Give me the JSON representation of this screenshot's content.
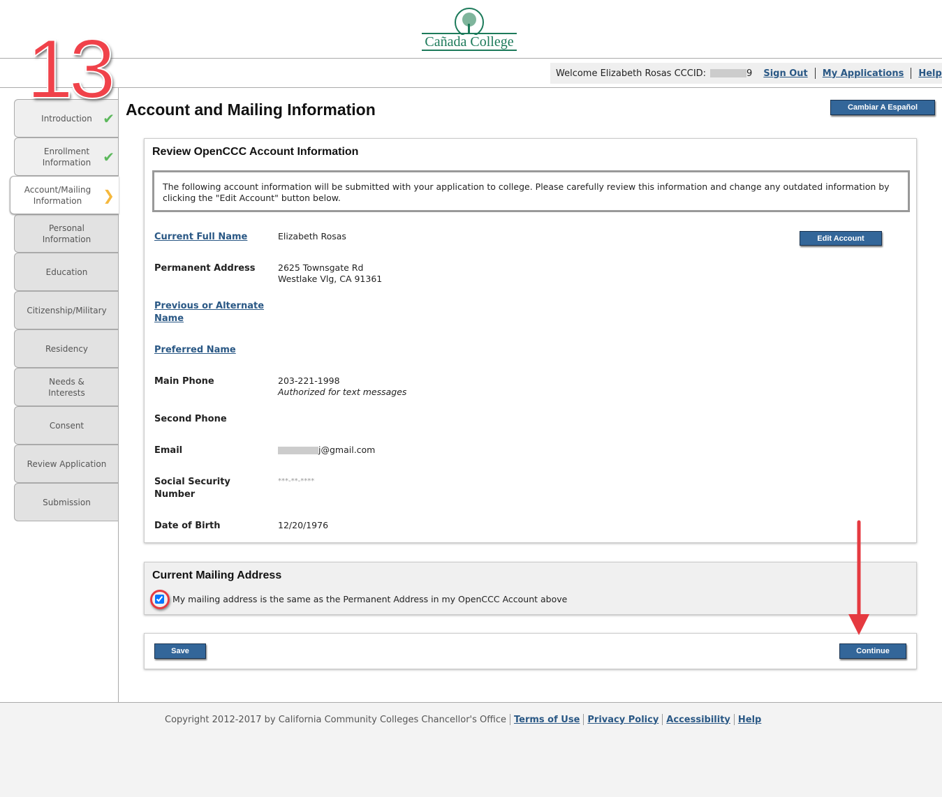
{
  "annotation": {
    "step_number": "13",
    "highlight_color": "#e53a40"
  },
  "header": {
    "logo_text": "Cañada College",
    "welcome": "Welcome Elizabeth Rosas CCCID:",
    "cccid_suffix": "9",
    "links": [
      "Sign Out",
      "My Applications",
      "Help"
    ]
  },
  "sidebar": {
    "items": [
      {
        "label": "Introduction",
        "status": "complete",
        "icon": "check-icon"
      },
      {
        "label": "Enrollment Information",
        "status": "complete",
        "icon": "check-icon"
      },
      {
        "label": "Account/Mailing Information",
        "status": "current",
        "icon": "chevron-right-icon"
      },
      {
        "label": "Personal Information",
        "status": "pending"
      },
      {
        "label": "Education",
        "status": "pending"
      },
      {
        "label": "Citizenship/Military",
        "status": "pending"
      },
      {
        "label": "Residency",
        "status": "pending"
      },
      {
        "label": "Needs & Interests",
        "status": "pending"
      },
      {
        "label": "Consent",
        "status": "pending"
      },
      {
        "label": "Review Application",
        "status": "pending"
      },
      {
        "label": "Submission",
        "status": "pending"
      }
    ]
  },
  "main": {
    "title": "Account and Mailing Information",
    "spanish_button": "Cambiar A Español",
    "review": {
      "heading": "Review OpenCCC Account Information",
      "notice": "The following account information will be submitted with your application to college. Please carefully review this information and change any outdated information by clicking the \"Edit Account\" button below.",
      "edit_button": "Edit Account",
      "fields": {
        "full_name": {
          "label": "Current Full Name",
          "value": "Elizabeth Rosas"
        },
        "address": {
          "label": "Permanent Address",
          "line1": "2625 Townsgate Rd",
          "line2": "Westlake Vlg, CA 91361"
        },
        "alt_name": {
          "label": "Previous or Alternate Name"
        },
        "preferred": {
          "label": "Preferred Name"
        },
        "main_phone": {
          "label": "Main Phone",
          "value": "203-221-1998",
          "note": "Authorized for text messages"
        },
        "second_phone": {
          "label": "Second Phone"
        },
        "email": {
          "label": "Email",
          "value_suffix": "j@gmail.com"
        },
        "ssn": {
          "label": "Social Security Number",
          "value": "***-**-****"
        },
        "dob": {
          "label": "Date of Birth",
          "value": "12/20/1976"
        }
      }
    },
    "mailing": {
      "heading": "Current Mailing Address",
      "checkbox_label": "My mailing address is the same as the Permanent Address in my OpenCCC Account above",
      "checked": true
    },
    "actions": {
      "save": "Save",
      "continue": "Continue"
    }
  },
  "footer": {
    "copyright": "Copyright 2012-2017 by California Community Colleges Chancellor's Office",
    "links": [
      "Terms of Use",
      "Privacy Policy",
      "Accessibility",
      "Help"
    ]
  }
}
